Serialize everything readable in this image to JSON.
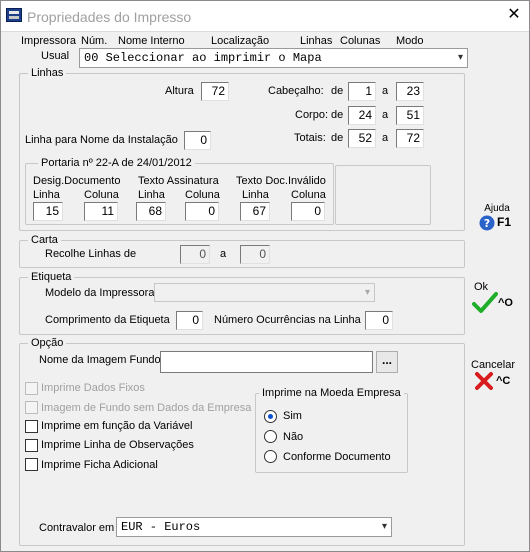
{
  "window": {
    "title": "Propriedades do Impresso",
    "close_glyph": "✕"
  },
  "header": {
    "impressora": "Impressora",
    "num": "Núm.",
    "nome_interno": "Nome Interno",
    "localizacao": "Localização",
    "linhas": "Linhas",
    "colunas": "Colunas",
    "modo": "Modo",
    "usual_label": "Usual",
    "usual_value": "00 Seleccionar ao imprimir o Mapa"
  },
  "linhas": {
    "title": "Linhas",
    "altura_label": "Altura",
    "altura_value": "72",
    "cabecalho_label": "Cabeçalho:",
    "cabecalho_de_label": "de",
    "cabecalho_from": "1",
    "cabecalho_a_label": "a",
    "cabecalho_to": "23",
    "corpo_label": "Corpo:",
    "corpo_de_label": "de",
    "corpo_from": "24",
    "corpo_a_label": "a",
    "corpo_to": "51",
    "totais_label": "Totais:",
    "totais_de_label": "de",
    "totais_from": "52",
    "totais_a_label": "a",
    "totais_to": "72",
    "nome_instalacao_label": "Linha para Nome da Instalação",
    "nome_instalacao_value": "0"
  },
  "portaria": {
    "title": "Portaria nº 22-A de 24/01/2012",
    "desig_label": "Desig.Documento",
    "assinatura_label": "Texto Assinatura",
    "invalido_label": "Texto Doc.Inválido",
    "linha_label": "Linha",
    "coluna_label": "Coluna",
    "desig_linha": "15",
    "desig_coluna": "11",
    "assin_linha": "68",
    "assin_coluna": "0",
    "inval_linha": "67",
    "inval_coluna": "0"
  },
  "carta": {
    "title": "Carta",
    "recolhe_label": "Recolhe Linhas de",
    "from": "0",
    "a_label": "a",
    "to": "0"
  },
  "etiqueta": {
    "title": "Etiqueta",
    "modelo_label": "Modelo da Impressora",
    "comprimento_label": "Comprimento da Etiqueta",
    "comprimento_value": "0",
    "ocorrencias_label": "Número Ocurrências na Linha",
    "ocorrencias_value": "0"
  },
  "opcao": {
    "title": "Opção",
    "imagem_label": "Nome da Imagem Fundo",
    "imagem_value": "",
    "browse_label": "...",
    "dados_fixos": "Imprime Dados Fixos",
    "imagem_sem_dados": "Imagem de Fundo sem Dados da Empresa",
    "em_funcao": "Imprime em função da Variável",
    "linha_obs": "Imprime Linha de Observações",
    "ficha_adicional": "Imprime Ficha Adicional",
    "moeda_title": "Imprime na Moeda Empresa",
    "moeda_options": [
      "Sim",
      "Não",
      "Conforme Documento"
    ],
    "moeda_selected": "Sim",
    "contravalor_label": "Contravalor em",
    "contravalor_value": "EUR  - Euros"
  },
  "side": {
    "ajuda": "Ajuda",
    "ajuda_key": "F1",
    "ok": "Ok",
    "ok_key": "^O",
    "cancelar": "Cancelar",
    "cancelar_key": "^C"
  }
}
